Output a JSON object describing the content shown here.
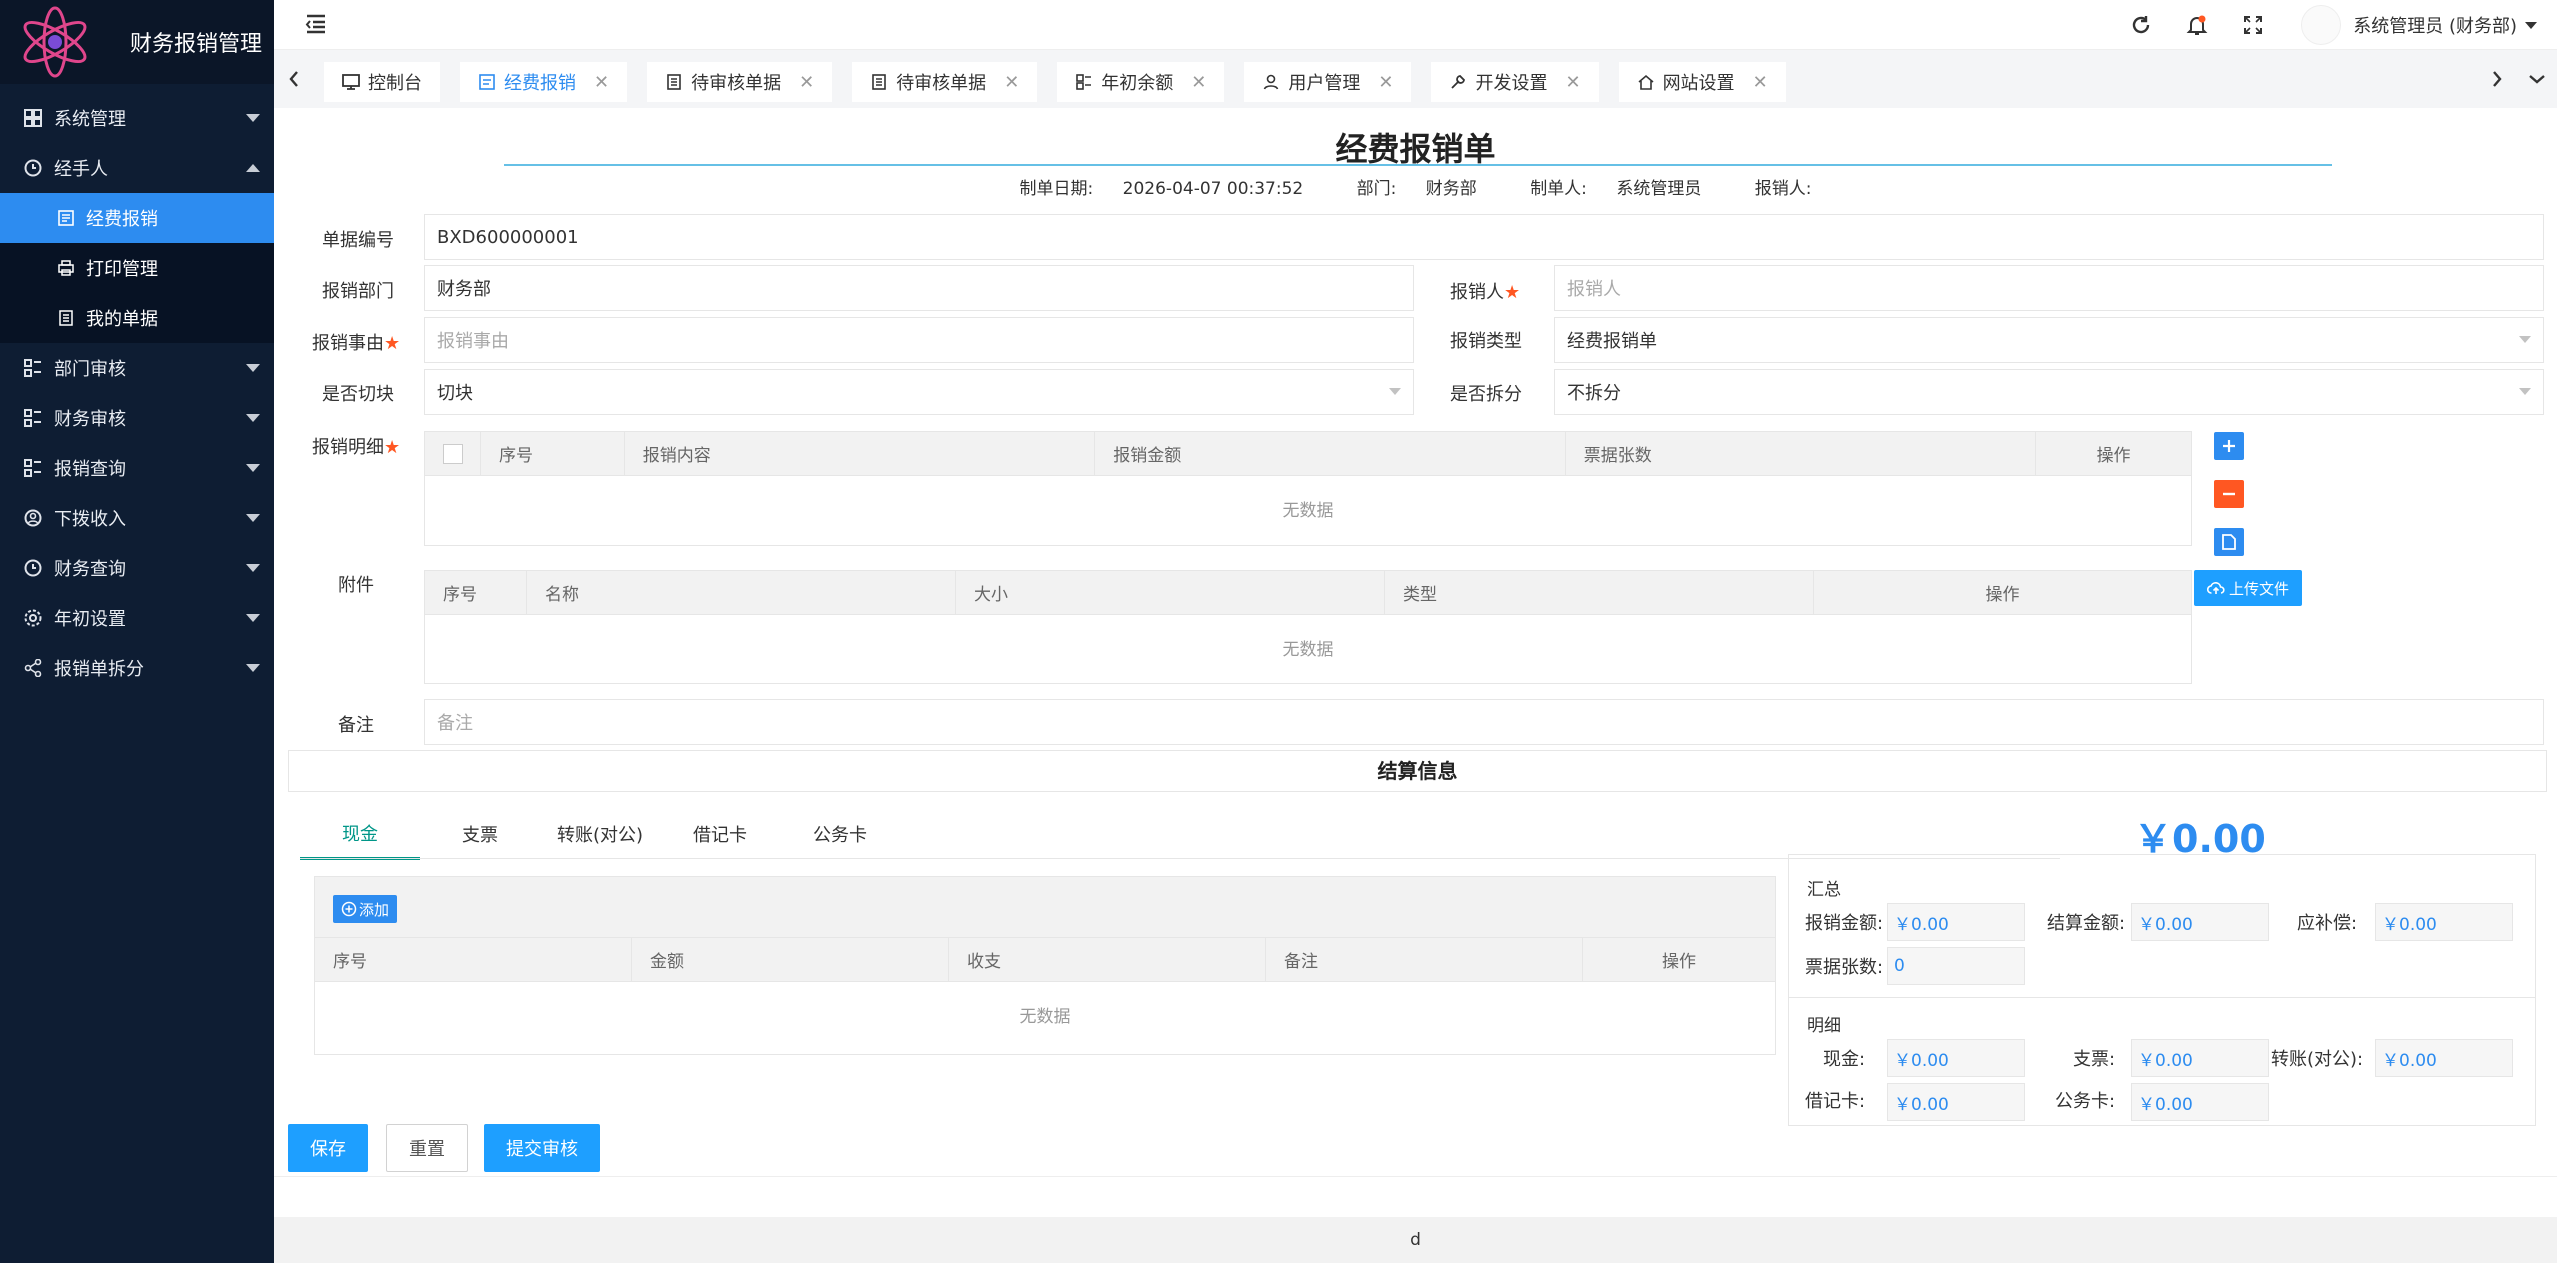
{
  "app": {
    "title": "财务报销管理"
  },
  "sidebar": {
    "items": [
      {
        "label": "系统管理"
      },
      {
        "label": "经手人",
        "children": [
          {
            "label": "经费报销"
          },
          {
            "label": "打印管理"
          },
          {
            "label": "我的单据"
          }
        ]
      },
      {
        "label": "部门审核"
      },
      {
        "label": "财务审核"
      },
      {
        "label": "报销查询"
      },
      {
        "label": "下拨收入"
      },
      {
        "label": "财务查询"
      },
      {
        "label": "年初设置"
      },
      {
        "label": "报销单拆分"
      }
    ]
  },
  "header": {
    "user": "系统管理员 (财务部)"
  },
  "tabs": [
    {
      "label": "控制台"
    },
    {
      "label": "经费报销"
    },
    {
      "label": "待审核单据"
    },
    {
      "label": "待审核单据"
    },
    {
      "label": "年初余额"
    },
    {
      "label": "用户管理"
    },
    {
      "label": "开发设置"
    },
    {
      "label": "网站设置"
    }
  ],
  "form": {
    "title": "经费报销单",
    "meta": {
      "date_label": "制单日期:",
      "date": "2026-04-07 00:37:52",
      "dept_label": "部门:",
      "dept": "财务部",
      "maker_label": "制单人:",
      "maker": "系统管理员",
      "claimant_label": "报销人:"
    },
    "bill_no": {
      "label": "单据编号",
      "value": "BXD600000001"
    },
    "dept": {
      "label": "报销部门",
      "value": "财务部"
    },
    "claimant": {
      "label": "报销人",
      "placeholder": "报销人"
    },
    "reason": {
      "label": "报销事由",
      "placeholder": "报销事由"
    },
    "type": {
      "label": "报销类型",
      "value": "经费报销单"
    },
    "cut": {
      "label": "是否切块",
      "value": "切块"
    },
    "split": {
      "label": "是否拆分",
      "value": "不拆分"
    },
    "details": {
      "label": "报销明细",
      "columns": [
        "序号",
        "报销内容",
        "报销金额",
        "票据张数",
        "操作"
      ],
      "empty": "无数据"
    },
    "attach": {
      "label": "附件",
      "columns": [
        "序号",
        "名称",
        "大小",
        "类型",
        "操作"
      ],
      "empty": "无数据",
      "upload": "上传文件"
    },
    "remark": {
      "label": "备注",
      "placeholder": "备注"
    }
  },
  "settle": {
    "title": "结算信息",
    "tabs": [
      "现金",
      "支票",
      "转账(对公)",
      "借记卡",
      "公务卡"
    ],
    "total": "￥0.00",
    "cash": {
      "add": "添加",
      "columns": [
        "序号",
        "金额",
        "收支",
        "备注",
        "操作"
      ],
      "empty": "无数据"
    },
    "summary": {
      "title": "汇总",
      "claim_label": "报销金额:",
      "claim": "￥0.00",
      "settle_label": "结算金额:",
      "settle": "￥0.00",
      "comp_label": "应补偿:",
      "comp": "￥0.00",
      "bills_label": "票据张数:",
      "bills": "0"
    },
    "detail": {
      "title": "明细",
      "cash_label": "现金:",
      "cash": "￥0.00",
      "check_label": "支票:",
      "check": "￥0.00",
      "transfer_label": "转账(对公):",
      "transfer": "￥0.00",
      "debit_label": "借记卡:",
      "debit": "￥0.00",
      "card_label": "公务卡:",
      "card": "￥0.00"
    }
  },
  "actions": {
    "save": "保存",
    "reset": "重置",
    "submit": "提交审核"
  },
  "footer": {
    "text": "d"
  },
  "colors": {
    "sidebar_bg": "#0e1d33",
    "accent": "#2d8cf0",
    "danger": "#ff5722",
    "tab_active": "#009688"
  }
}
